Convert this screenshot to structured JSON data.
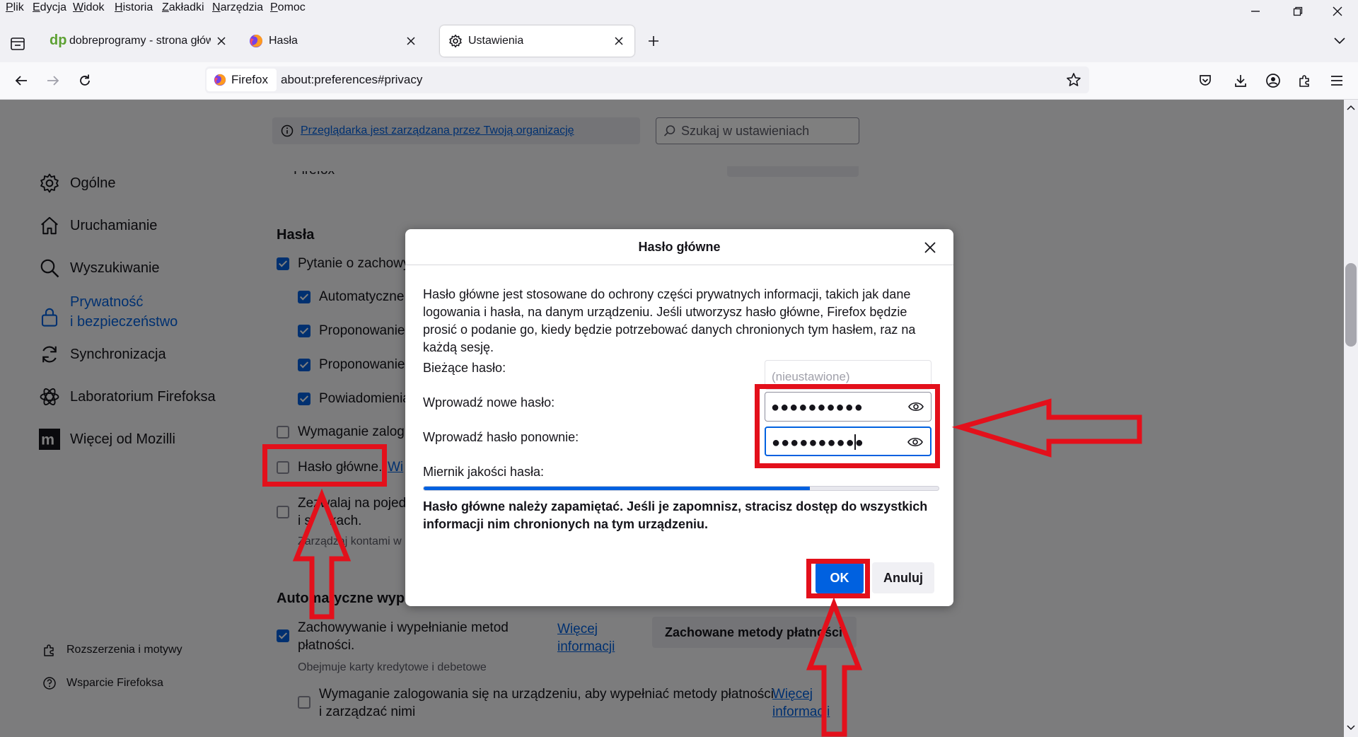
{
  "menu": [
    "Plik",
    "Edycja",
    "Widok",
    "Historia",
    "Zakładki",
    "Narzędzia",
    "Pomoc"
  ],
  "tabs": [
    {
      "title": "dobreprogramy - strona główna",
      "icon": "dp-logo-icon"
    },
    {
      "title": "Hasła",
      "icon": "firefox-icon"
    },
    {
      "title": "Ustawienia",
      "icon": "gear-icon",
      "active": true
    }
  ],
  "urlbar": {
    "identity": "Firefox",
    "url": "about:preferences#privacy"
  },
  "prefs": {
    "managed_notice": "Przeglądarka jest zarządzana przez Twoją organizację",
    "search_placeholder": "Szukaj w ustawieniach",
    "sidebar": [
      {
        "label": "Ogólne",
        "icon": "gear-icon"
      },
      {
        "label": "Uruchamianie",
        "icon": "home-icon"
      },
      {
        "label": "Wyszukiwanie",
        "icon": "search-icon"
      },
      {
        "label": "Prywatność",
        "label2": "i bezpieczeństwo",
        "icon": "lock-icon",
        "selected": true
      },
      {
        "label": "Synchronizacja",
        "icon": "sync-icon"
      },
      {
        "label": "Laboratorium Firefoksa",
        "icon": "flask-icon"
      },
      {
        "label": "Więcej od Mozilli",
        "icon": "mozilla-icon"
      }
    ],
    "sidebar_bottom": [
      {
        "label": "Rozszerzenia i motywy",
        "icon": "puzzle-icon"
      },
      {
        "label": "Wsparcie Firefoksa",
        "icon": "help-icon"
      }
    ],
    "partial_top_text": "Firefox",
    "passwords_heading": "Hasła",
    "options": [
      {
        "label": "Pytanie o zachowy",
        "checked": true
      },
      {
        "label": "Automatyczne",
        "checked": true
      },
      {
        "label": "Proponowanie",
        "checked": true
      },
      {
        "label": "Proponowanie",
        "checked": true
      },
      {
        "label": "Powiadomienia",
        "checked": true
      },
      {
        "label": "Wymaganie zalog",
        "checked": false
      },
      {
        "label": "Hasło główne.",
        "checked": false,
        "link": "Wi"
      },
      {
        "label": "Zezwalaj na pojedy",
        "label2": "i s",
        "label3": "kach.",
        "checked": false
      }
    ],
    "manage_accounts_text": "Zarządzaj kontami w",
    "autofill_heading": "Automatyczne wyp",
    "payment_option": {
      "line1": "Zachowywanie i wypełnianie metod",
      "line2": "płatności.",
      "checked": true
    },
    "payment_link": {
      "line1": "Więcej",
      "line2": "informacji"
    },
    "saved_methods_button": "Zachowane metody płatności",
    "payment_caption": "Obejmuje karty kredytowe i debetowe",
    "payment_login_option": {
      "line1": "Wymaganie zalogowania się na urządzeniu, aby wypełniać metody płatności",
      "line2": "i zarządzać nimi",
      "checked": false
    },
    "payment_login_link": {
      "line1": "Więcej",
      "line2": "informacji"
    }
  },
  "dialog": {
    "title": "Hasło główne",
    "description": "Hasło główne jest stosowane do ochrony części prywatnych informacji, takich jak dane logowania i hasła, na danym urządzeniu. Jeśli utworzysz hasło główne, Firefox będzie prosić o podanie go, kiedy będzie potrzebować danych chronionych tym hasłem, raz na każdą sesję.",
    "current_label": "Bieżące hasło:",
    "current_placeholder": "(nieustawione)",
    "new_label": "Wprowadź nowe hasło:",
    "new_value": "●●●●●●●●●●",
    "repeat_label": "Wprowadź hasło ponownie:",
    "repeat_value": "●●●●●●●●●●",
    "meter_label": "Miernik jakości hasła:",
    "meter_level": 0.75,
    "warning": "Hasło główne należy zapamiętać. Jeśli je zapomnisz, stracisz dostęp do wszystkich informacji nim chronionych na tym urządzeniu.",
    "ok_label": "OK",
    "cancel_label": "Anuluj"
  },
  "colors": {
    "accent": "#0061e0",
    "annotation": "#e3101b"
  }
}
